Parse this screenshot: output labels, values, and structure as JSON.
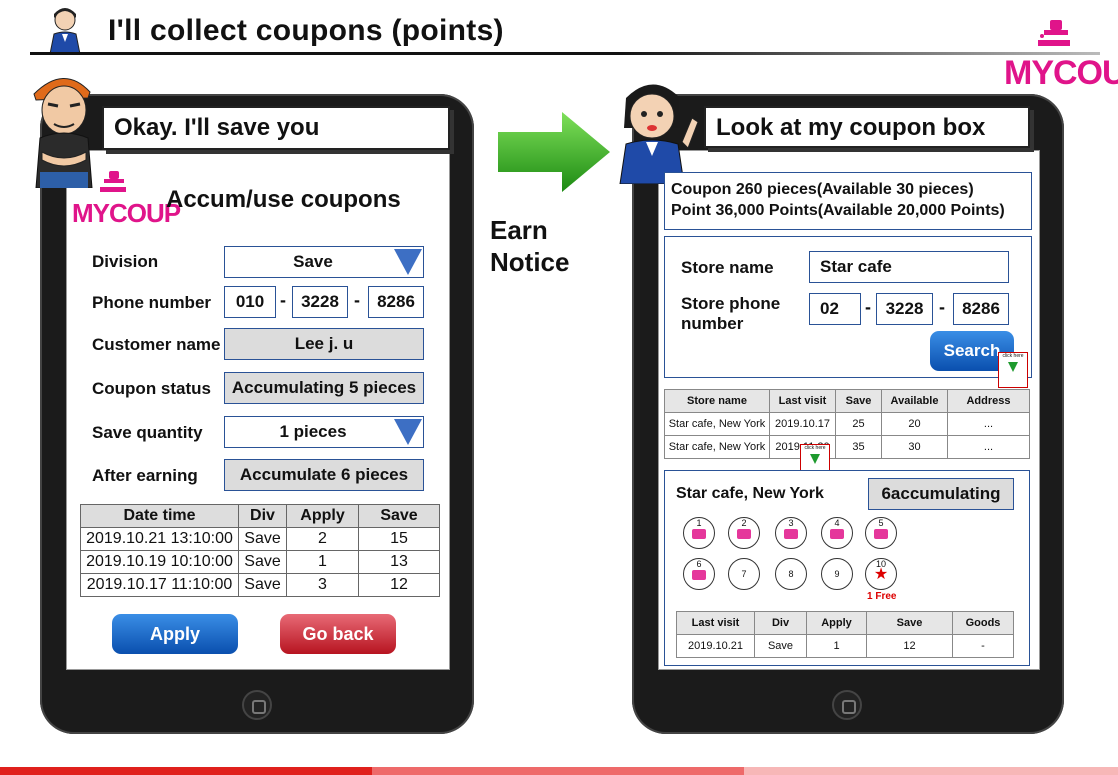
{
  "header": {
    "title": "I'll collect coupons (points)"
  },
  "brand": {
    "logo": "MYCOUP",
    "color": "#e0148a"
  },
  "middle": {
    "line1": "Earn",
    "line2": "Notice"
  },
  "left": {
    "speech": "Okay. I'll save you",
    "title": "Accum/use coupons",
    "logo": "MYCOUP",
    "division_label": "Division",
    "division_value": "Save",
    "phone_label": "Phone number",
    "phone": [
      "010",
      "3228",
      "8286"
    ],
    "customer_label": "Customer name",
    "customer_value": "Lee j. u",
    "status_label": "Coupon status",
    "status_value": "Accumulating 5 pieces",
    "qty_label": "Save quantity",
    "qty_value": "1 pieces",
    "after_label": "After earning",
    "after_value": "Accumulate 6 pieces",
    "table": {
      "headers": [
        "Date time",
        "Div",
        "Apply",
        "Save"
      ],
      "rows": [
        [
          "2019.10.21 13:10:00",
          "Save",
          "2",
          "15"
        ],
        [
          "2019.10.19 10:10:00",
          "Save",
          "1",
          "13"
        ],
        [
          "2019.10.17 11:10:00",
          "Save",
          "3",
          "12"
        ]
      ]
    },
    "apply_button": "Apply",
    "back_button": "Go back"
  },
  "right": {
    "speech": "Look at my coupon box",
    "summary_line1": "Coupon 260 pieces(Available 30 pieces)",
    "summary_line2": "Point 36,000 Points(Available 20,000 Points)",
    "store_label": "Store name",
    "store_value": "Star cafe",
    "phone_label_1": "Store phone",
    "phone_label_2": "number",
    "phone": [
      "02",
      "3228",
      "8286"
    ],
    "search_button": "Search",
    "click_hint": "click here",
    "table": {
      "headers": [
        "Store name",
        "Last visit",
        "Save",
        "Available",
        "Address"
      ],
      "rows": [
        [
          "Star cafe, New York",
          "2019.10.17",
          "25",
          "20",
          "..."
        ],
        [
          "Star cafe, New York",
          "2019.11.20",
          "35",
          "30",
          "..."
        ]
      ]
    },
    "detail_store": "Star cafe, New York",
    "detail_status": "6accumulating",
    "stamps": [
      "1",
      "2",
      "3",
      "4",
      "5",
      "6",
      "7",
      "8",
      "9",
      "10"
    ],
    "free_label": "1 Free",
    "detail_table": {
      "headers": [
        "Last visit",
        "Div",
        "Apply",
        "Save",
        "Goods"
      ],
      "rows": [
        [
          "2019.10.21",
          "Save",
          "1",
          "12",
          "-"
        ]
      ]
    }
  }
}
